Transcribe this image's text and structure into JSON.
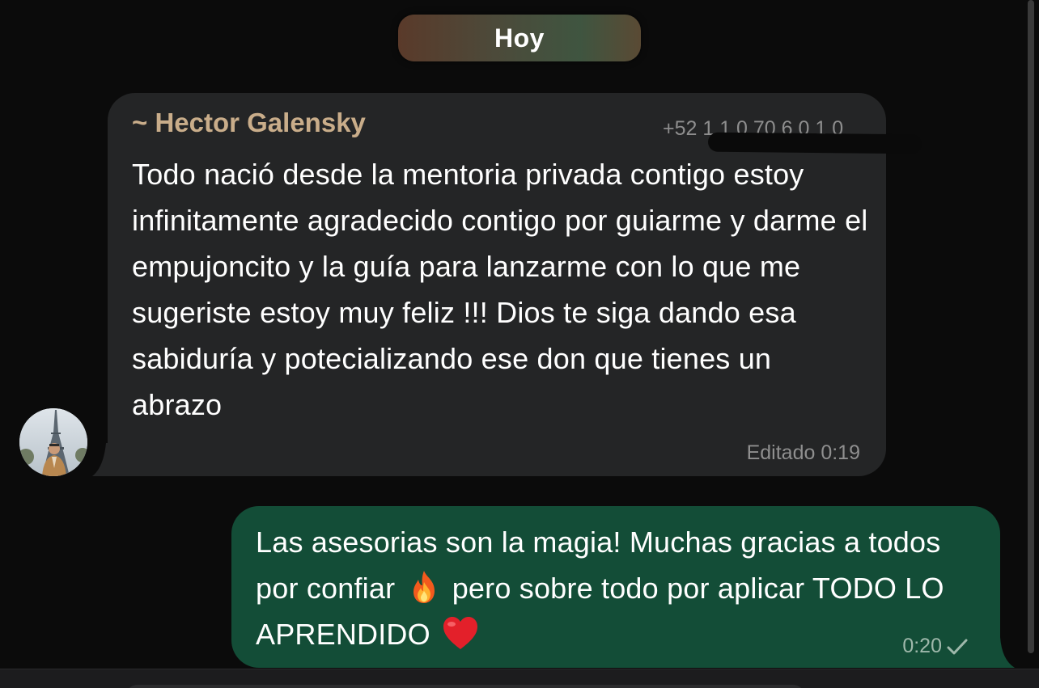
{
  "date_separator": {
    "label": "Hoy"
  },
  "incoming_message": {
    "sender_name": "~ Hector Galensky",
    "sender_phone": "+52 1 1 0 70 6 0 1 0",
    "text": "Todo nació desde la mentoria privada contigo estoy infinitamente agradecido contigo por guiarme y darme el empujoncito y la guía para lanzarme con lo que me sugeriste estoy muy feliz !!! Dios te siga dando esa sabiduría y potecializando ese don que tienes un abrazo",
    "meta": "Editado 0:19",
    "avatar_icon": "profile-photo-eiffel-tower"
  },
  "outgoing_message": {
    "text_part1": "Las asesorias son la magia! Muchas gracias a todos por confiar",
    "emoji1_icon": "fire-emoji",
    "text_part2": "pero sobre todo por aplicar TODO LO APRENDIDO",
    "emoji2_icon": "red-heart-emoji",
    "time": "0:20",
    "status_icon": "single-check-icon"
  },
  "colors": {
    "background": "#0b0b0b",
    "incoming_bubble": "#242526",
    "outgoing_bubble": "#134d37",
    "sender_name": "#c9ad8a"
  }
}
